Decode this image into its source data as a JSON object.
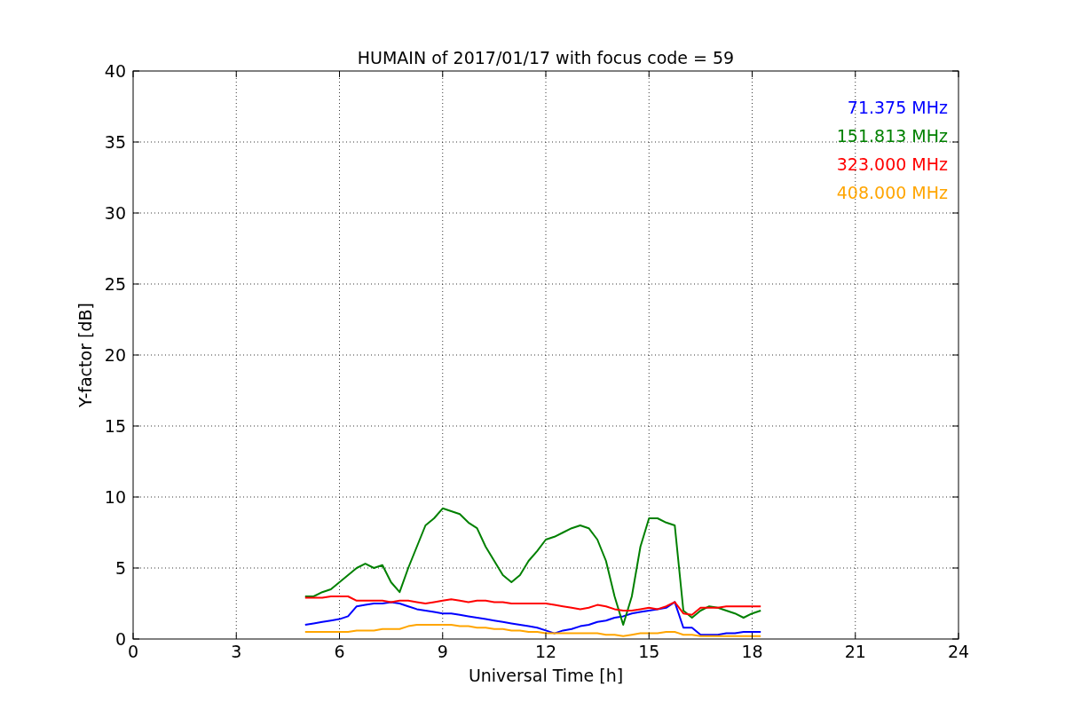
{
  "chart_data": {
    "type": "line",
    "title": "HUMAIN of 2017/01/17 with focus code = 59",
    "xlabel": "Universal Time [h]",
    "ylabel": "Y-factor [dB]",
    "x": [
      5,
      5.25,
      5.5,
      5.75,
      6,
      6.25,
      6.5,
      6.75,
      7,
      7.25,
      7.5,
      7.75,
      8,
      8.25,
      8.5,
      8.75,
      9,
      9.25,
      9.5,
      9.75,
      10,
      10.25,
      10.5,
      10.75,
      11,
      11.25,
      11.5,
      11.75,
      12,
      12.25,
      12.5,
      12.75,
      13,
      13.25,
      13.5,
      13.75,
      14,
      14.25,
      14.5,
      14.75,
      15,
      15.25,
      15.5,
      15.75,
      16,
      16.25,
      16.5,
      16.75,
      17,
      17.25,
      17.5,
      17.75,
      18,
      18.25
    ],
    "series": [
      {
        "name": "71.375 MHz",
        "color": "#0000ff",
        "values": [
          1.0,
          1.1,
          1.2,
          1.3,
          1.4,
          1.6,
          2.3,
          2.4,
          2.5,
          2.5,
          2.6,
          2.5,
          2.3,
          2.1,
          2.0,
          1.9,
          1.8,
          1.8,
          1.7,
          1.6,
          1.5,
          1.4,
          1.3,
          1.2,
          1.1,
          1.0,
          0.9,
          0.8,
          0.6,
          0.4,
          0.6,
          0.7,
          0.9,
          1.0,
          1.2,
          1.3,
          1.5,
          1.6,
          1.8,
          1.9,
          2.0,
          2.1,
          2.2,
          2.6,
          0.8,
          0.8,
          0.3,
          0.3,
          0.3,
          0.4,
          0.4,
          0.5,
          0.5,
          0.5
        ]
      },
      {
        "name": "151.813 MHz",
        "color": "#008000",
        "values": [
          3.0,
          3.0,
          3.3,
          3.5,
          4.0,
          4.5,
          5.0,
          5.3,
          5.0,
          5.2,
          4.0,
          3.3,
          5.0,
          6.5,
          8.0,
          8.5,
          9.2,
          9.0,
          8.8,
          8.2,
          7.8,
          6.5,
          5.5,
          4.5,
          4.0,
          4.5,
          5.5,
          6.2,
          7.0,
          7.2,
          7.5,
          7.8,
          8.0,
          7.8,
          7.0,
          5.5,
          3.0,
          1.0,
          3.0,
          6.5,
          8.5,
          8.5,
          8.2,
          8.0,
          2.0,
          1.5,
          2.0,
          2.3,
          2.2,
          2.0,
          1.8,
          1.5,
          1.8,
          2.0
        ]
      },
      {
        "name": "323.000 MHz",
        "color": "#ff0000",
        "values": [
          2.9,
          2.9,
          2.9,
          3.0,
          3.0,
          3.0,
          2.7,
          2.7,
          2.7,
          2.7,
          2.6,
          2.7,
          2.7,
          2.6,
          2.5,
          2.6,
          2.7,
          2.8,
          2.7,
          2.6,
          2.7,
          2.7,
          2.6,
          2.6,
          2.5,
          2.5,
          2.5,
          2.5,
          2.5,
          2.4,
          2.3,
          2.2,
          2.1,
          2.2,
          2.4,
          2.3,
          2.1,
          2.0,
          2.0,
          2.1,
          2.2,
          2.1,
          2.3,
          2.6,
          1.8,
          1.7,
          2.2,
          2.2,
          2.2,
          2.3,
          2.3,
          2.3,
          2.3,
          2.3
        ]
      },
      {
        "name": "408.000 MHz",
        "color": "#ffa500",
        "values": [
          0.5,
          0.5,
          0.5,
          0.5,
          0.5,
          0.5,
          0.6,
          0.6,
          0.6,
          0.7,
          0.7,
          0.7,
          0.9,
          1.0,
          1.0,
          1.0,
          1.0,
          1.0,
          0.9,
          0.9,
          0.8,
          0.8,
          0.7,
          0.7,
          0.6,
          0.6,
          0.5,
          0.5,
          0.4,
          0.4,
          0.4,
          0.4,
          0.4,
          0.4,
          0.4,
          0.3,
          0.3,
          0.2,
          0.3,
          0.4,
          0.4,
          0.4,
          0.5,
          0.5,
          0.3,
          0.3,
          0.2,
          0.2,
          0.2,
          0.2,
          0.2,
          0.2,
          0.2,
          0.2
        ]
      }
    ],
    "xlim": [
      0,
      24
    ],
    "ylim": [
      0,
      40
    ],
    "xticks": [
      0,
      3,
      6,
      9,
      12,
      15,
      18,
      21,
      24
    ],
    "yticks": [
      0,
      5,
      10,
      15,
      20,
      25,
      30,
      35,
      40
    ],
    "grid": true
  }
}
